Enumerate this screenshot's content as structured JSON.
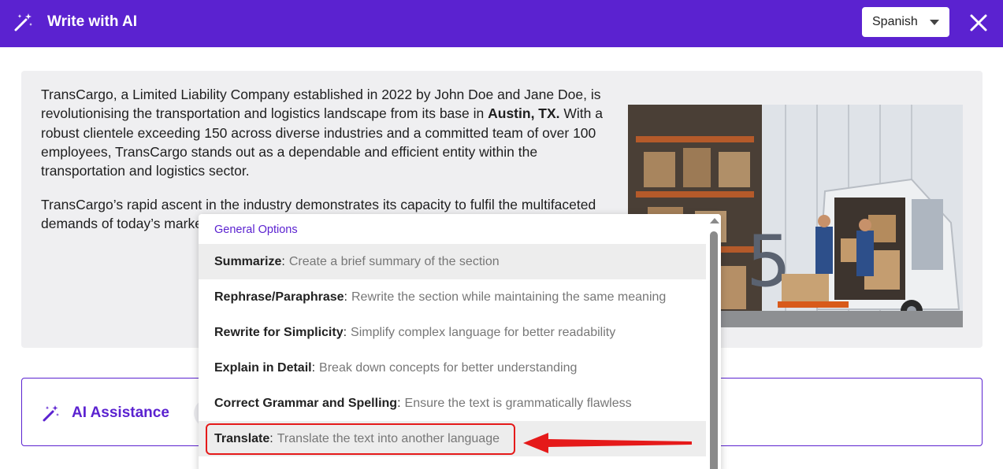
{
  "header": {
    "title": "Write with AI",
    "language_selected": "Spanish",
    "color": "#5b22d0"
  },
  "content": {
    "para1_a": "TransCargo, a Limited Liability Company established in 2022 by John Doe and Jane Doe, is revolutionising the transportation and logistics landscape from its base in ",
    "para1_bold": "Austin, TX.",
    "para1_b": " With a robust clientele exceeding 150 across diverse industries and a committed team of over 100 employees, TransCargo stands out as a dependable and efficient entity within the transportation and logistics sector.",
    "para2": "TransCargo’s rapid ascent in the industry demonstrates its capacity to fulfil the multifaceted demands of today’s market driving force behind sustain is at the forefront of meeting"
  },
  "ai_assistance": {
    "label": "AI Assistance"
  },
  "dropdown": {
    "group_label": "General Options",
    "options": [
      {
        "name": "Summarize",
        "desc": "Create a brief summary of the section"
      },
      {
        "name": "Rephrase/Paraphrase",
        "desc": "Rewrite the section while maintaining the same meaning"
      },
      {
        "name": "Rewrite for Simplicity",
        "desc": "Simplify complex language for better readability"
      },
      {
        "name": "Explain in Detail",
        "desc": "Break down concepts for better understanding"
      },
      {
        "name": "Correct Grammar and Spelling",
        "desc": "Ensure the text is grammatically flawless"
      },
      {
        "name": "Translate",
        "desc": "Translate the text into another language"
      }
    ]
  },
  "annotation": {
    "highlight_color": "#e51a1a"
  }
}
